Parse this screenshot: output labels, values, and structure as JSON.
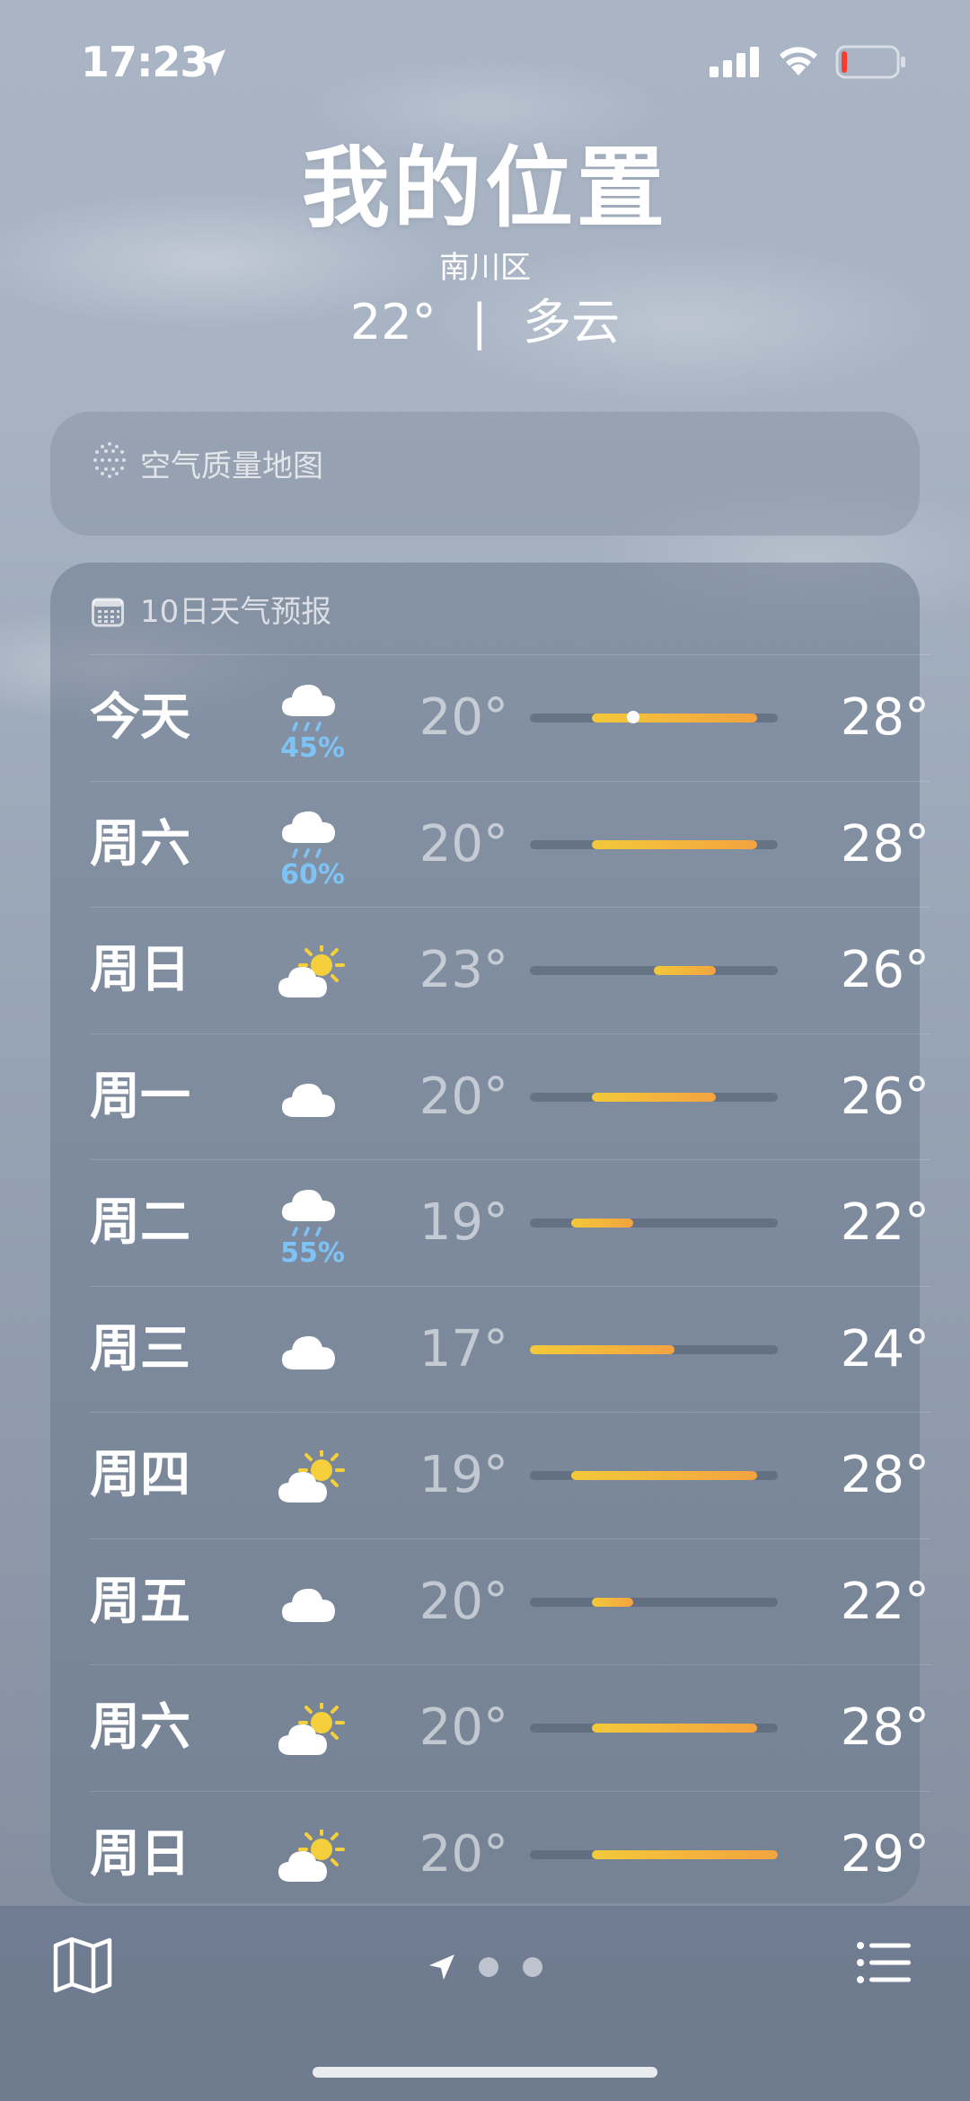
{
  "status_bar": {
    "time": "17:23",
    "signal_bars": 4,
    "battery_level": 0.08
  },
  "header": {
    "title": "我的位置",
    "district": "南川区",
    "current_temp": "22°",
    "separator": "|",
    "condition": "多云"
  },
  "air_quality": {
    "label": "空气质量地图"
  },
  "forecast": {
    "title": "10日天气预报",
    "days": [
      {
        "day": "今天",
        "icon": "cloud-rain-icon",
        "precip": "45%",
        "low": "20°",
        "high": "28°",
        "low_value": 20,
        "high_value": 28,
        "current_value": 22
      },
      {
        "day": "周六",
        "icon": "cloud-rain-icon",
        "precip": "60%",
        "low": "20°",
        "high": "28°",
        "low_value": 20,
        "high_value": 28
      },
      {
        "day": "周日",
        "icon": "partly-sunny-icon",
        "precip": "",
        "low": "23°",
        "high": "26°",
        "low_value": 23,
        "high_value": 26
      },
      {
        "day": "周一",
        "icon": "cloud-icon",
        "precip": "",
        "low": "20°",
        "high": "26°",
        "low_value": 20,
        "high_value": 26
      },
      {
        "day": "周二",
        "icon": "cloud-rain-icon",
        "precip": "55%",
        "low": "19°",
        "high": "22°",
        "low_value": 19,
        "high_value": 22
      },
      {
        "day": "周三",
        "icon": "cloud-icon",
        "precip": "",
        "low": "17°",
        "high": "24°",
        "low_value": 17,
        "high_value": 24
      },
      {
        "day": "周四",
        "icon": "partly-sunny-icon",
        "precip": "",
        "low": "19°",
        "high": "28°",
        "low_value": 19,
        "high_value": 28
      },
      {
        "day": "周五",
        "icon": "cloud-icon",
        "precip": "",
        "low": "20°",
        "high": "22°",
        "low_value": 20,
        "high_value": 22
      },
      {
        "day": "周六",
        "icon": "partly-sunny-icon",
        "precip": "",
        "low": "20°",
        "high": "28°",
        "low_value": 20,
        "high_value": 28
      },
      {
        "day": "周日",
        "icon": "partly-sunny-icon",
        "precip": "",
        "low": "20°",
        "high": "29°",
        "low_value": 20,
        "high_value": 29
      }
    ]
  },
  "toolbar": {
    "page_count": 3,
    "active_page": 0
  },
  "colors": {
    "bar_start": "#f3c93a",
    "bar_end": "#f3a340",
    "precip_text": "#7ec3f6",
    "sun": "#f5d03c"
  }
}
